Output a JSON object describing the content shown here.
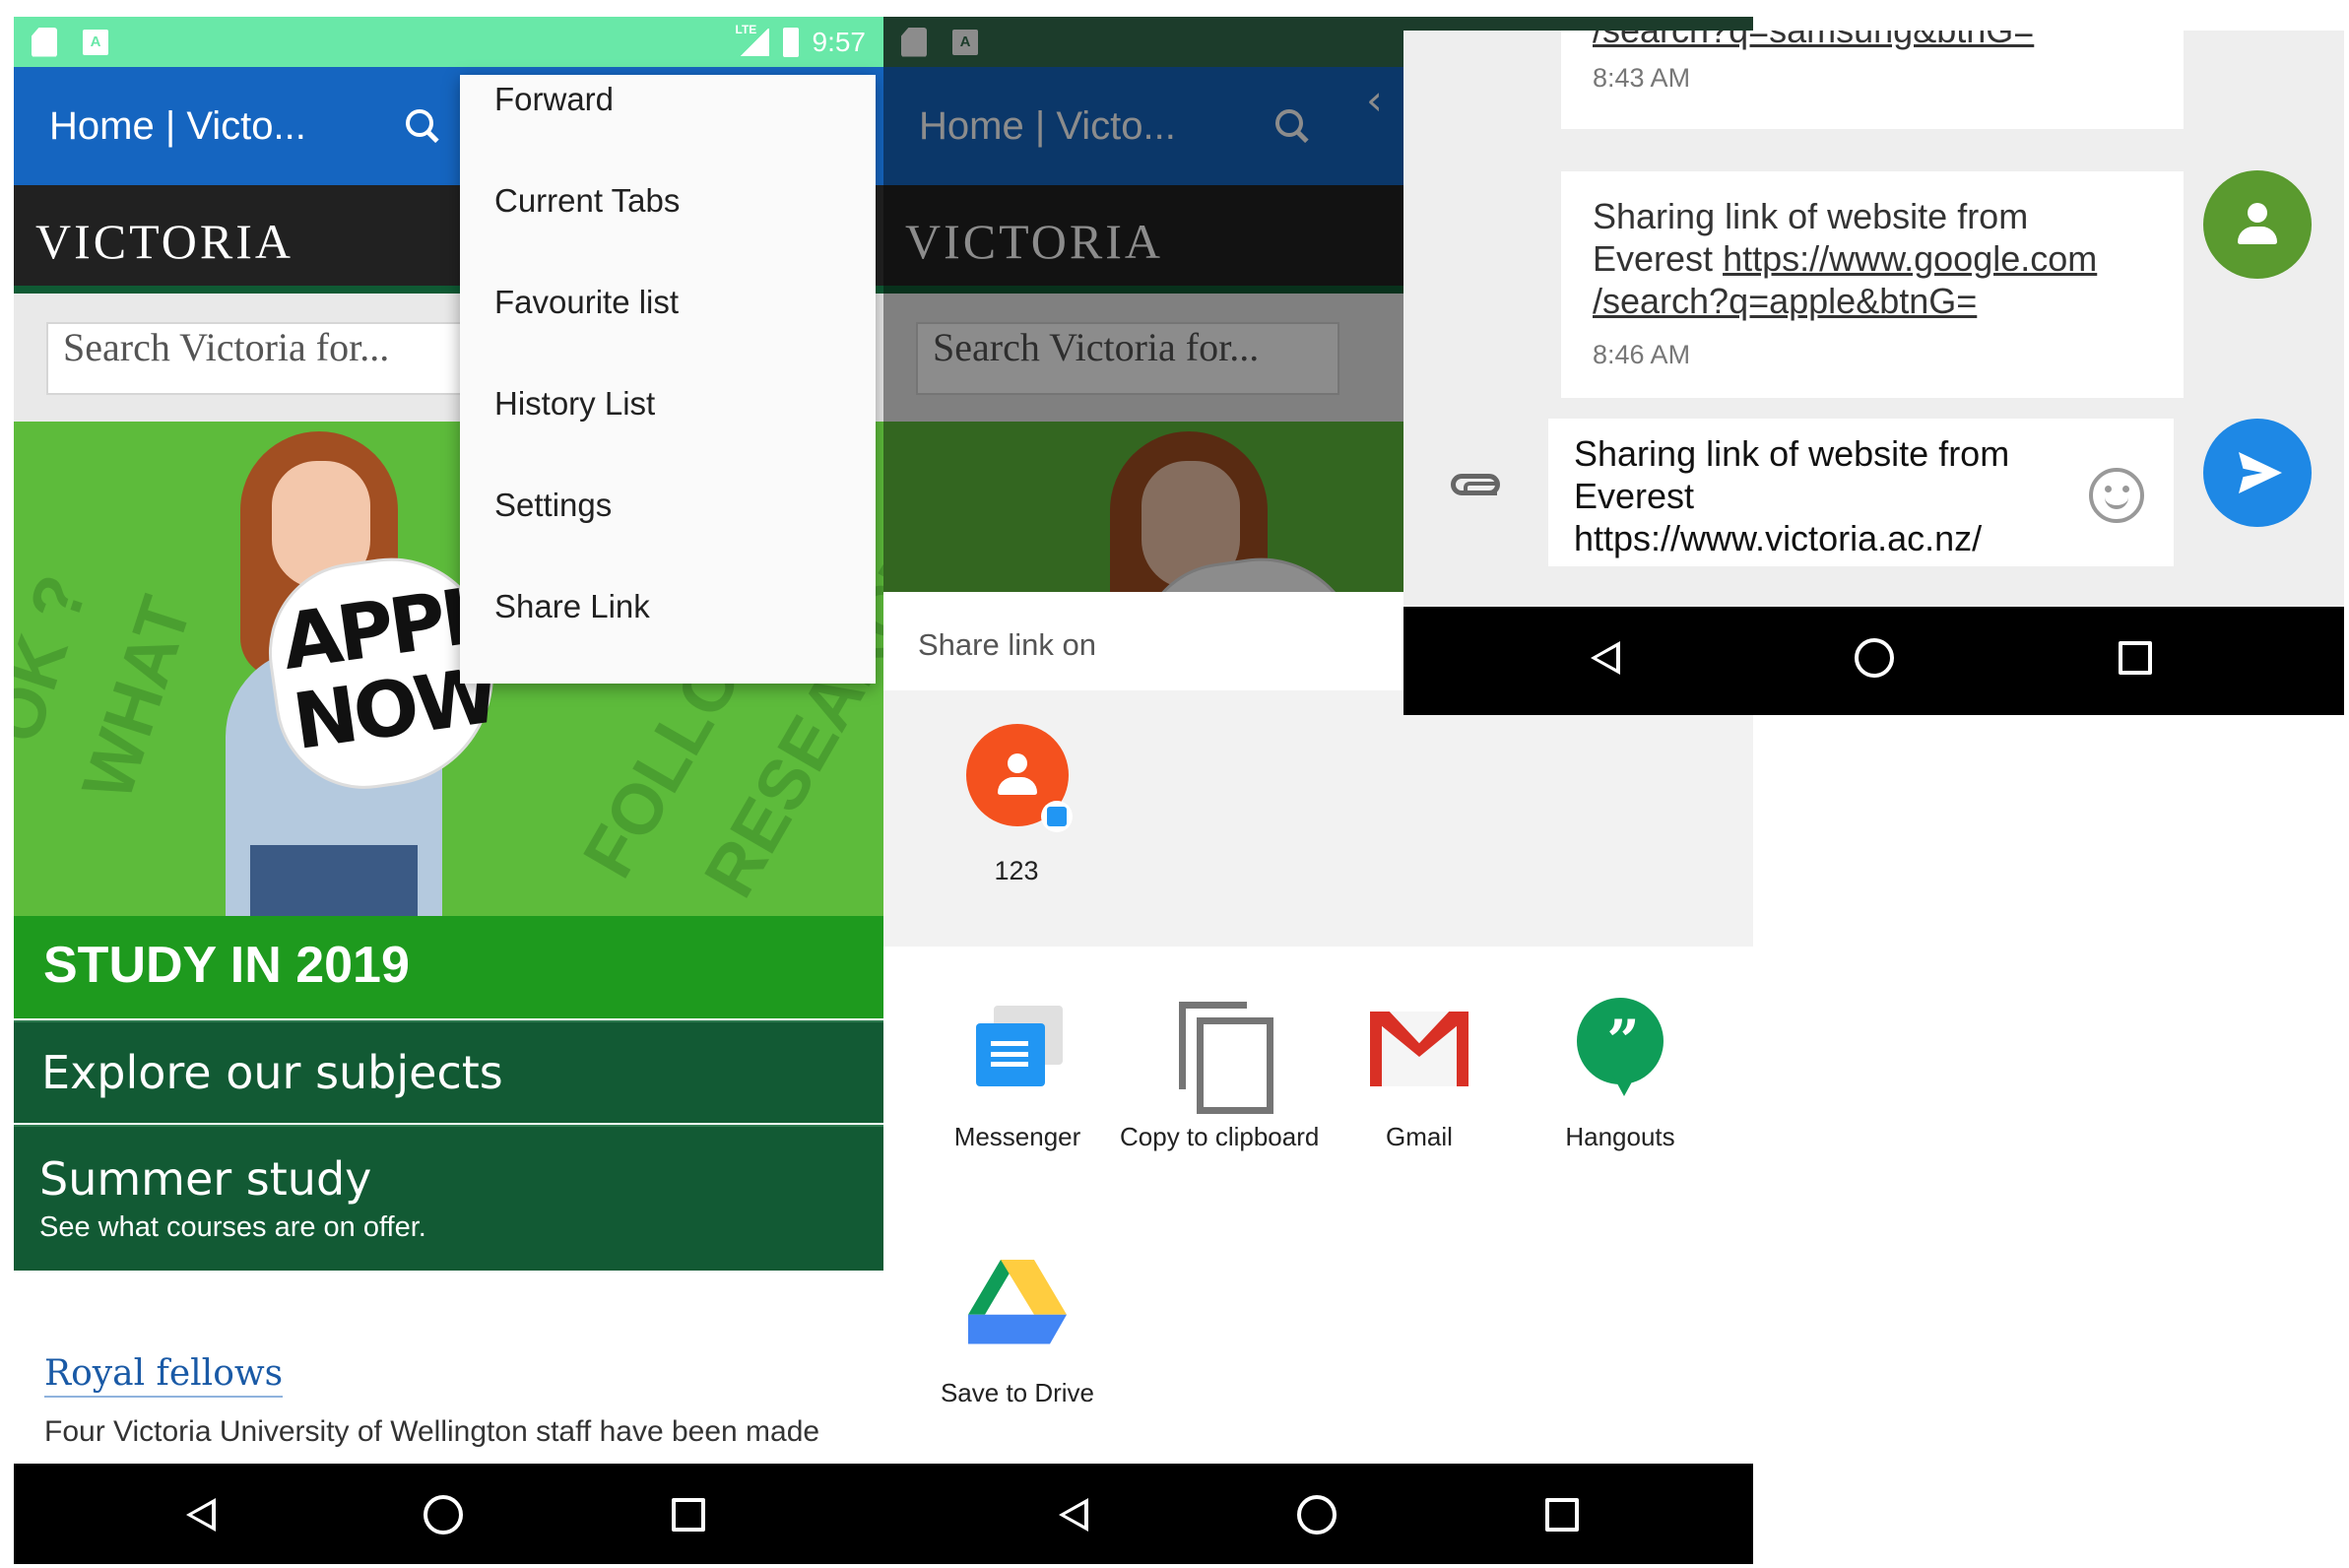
{
  "screen1": {
    "status": {
      "network": "LTE",
      "time": "9:57"
    },
    "appbar": {
      "title": "Home | Victo..."
    },
    "brand": "VICTORIA",
    "search": {
      "placeholder": "Search Victoria for..."
    },
    "hero": {
      "sign_text": "APPLY NOW"
    },
    "banner": "STUDY IN 2019",
    "links": [
      {
        "title": "Explore our subjects"
      },
      {
        "title": "Summer study",
        "subtitle": "See what courses are on offer."
      }
    ],
    "news": {
      "title": "Royal fellows",
      "excerpt": "Four Victoria University of Wellington staff have been made"
    },
    "menu": {
      "items": [
        "Forward",
        "Current Tabs",
        "Favourite list",
        "History List",
        "Settings",
        "Share Link"
      ]
    }
  },
  "screen2": {
    "appbar": {
      "title": "Home | Victo..."
    },
    "brand": "VICTORIA",
    "search": {
      "placeholder": "Search Victoria for..."
    },
    "share": {
      "title": "Share link on",
      "direct_contact": "123",
      "apps": [
        "Messenger",
        "Copy to clipboard",
        "Gmail",
        "Hangouts",
        "Save to Drive"
      ]
    }
  },
  "screen3": {
    "messages": [
      {
        "partial_link": "/search?q=samsung&btnG=",
        "time": "8:43 AM"
      },
      {
        "text": "Sharing link of website from Everest",
        "link_line1": "https://www.google.com",
        "link_line2": "/search?q=apple&btnG=",
        "time": "8:46 AM"
      }
    ],
    "compose": {
      "line1": "Sharing link of website from",
      "line2": "Everest",
      "line3": "https://www.victoria.ac.nz/"
    }
  },
  "colors": {
    "status_green": "#69e8a8",
    "appbar_blue": "#1565c0",
    "study_green": "#1e9a1e",
    "dark_green": "#125a34",
    "contact_orange": "#f4511e",
    "avatar_green": "#5a9a2f",
    "send_blue": "#1e88e5"
  },
  "icons": [
    "sd-card-icon",
    "a-icon",
    "lte-signal-icon",
    "battery-icon",
    "search-icon",
    "back-icon",
    "home-icon",
    "recents-icon",
    "person-icon",
    "messenger-icon",
    "copy-icon",
    "gmail-icon",
    "hangouts-icon",
    "drive-icon",
    "paperclip-icon",
    "emoji-icon",
    "send-icon"
  ]
}
